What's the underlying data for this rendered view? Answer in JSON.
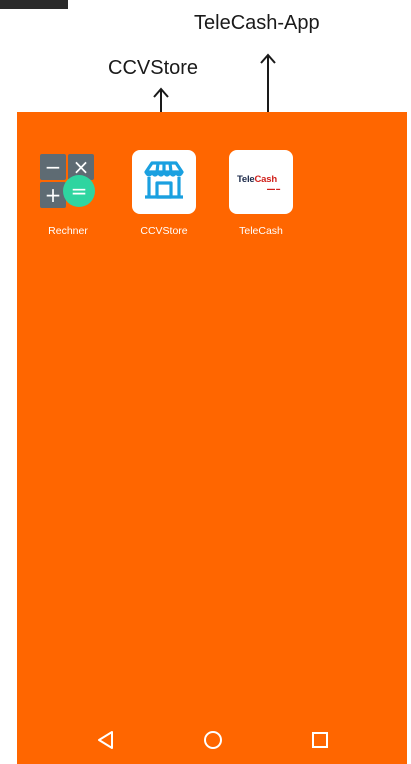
{
  "callouts": {
    "telecash_app": "TeleCash-App",
    "ccvstore": "CCVStore"
  },
  "apps": [
    {
      "label": "Rechner",
      "icon": "calculator-icon"
    },
    {
      "label": "CCVStore",
      "icon": "store-icon"
    },
    {
      "label": "TeleCash",
      "icon": "telecash-logo-icon",
      "logo_text": "TeleCash"
    }
  ],
  "navigation": {
    "back_icon": "back-triangle-icon",
    "home_icon": "home-circle-icon",
    "recent_icon": "recent-square-icon"
  },
  "colors": {
    "screen_background": "#ff6600",
    "store_icon": "#1aa0e0",
    "calculator_equals": "#2ed5a0"
  }
}
